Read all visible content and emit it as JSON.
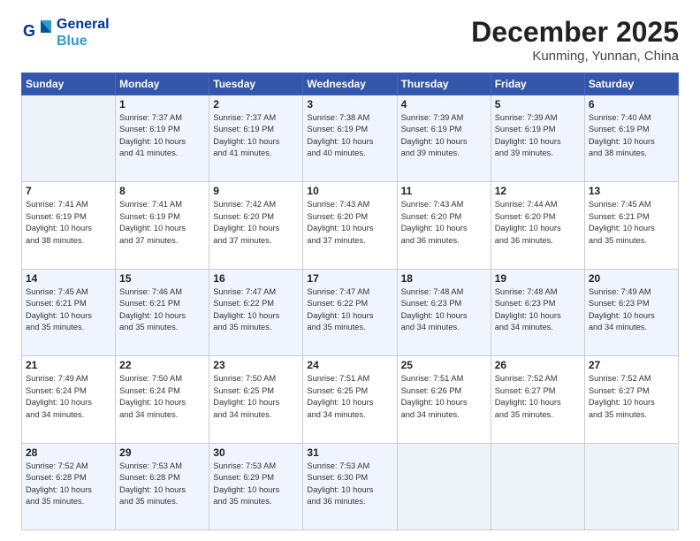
{
  "logo": {
    "line1": "General",
    "line2": "Blue"
  },
  "title": "December 2025",
  "location": "Kunming, Yunnan, China",
  "weekdays": [
    "Sunday",
    "Monday",
    "Tuesday",
    "Wednesday",
    "Thursday",
    "Friday",
    "Saturday"
  ],
  "weeks": [
    [
      {
        "day": "",
        "detail": ""
      },
      {
        "day": "1",
        "detail": "Sunrise: 7:37 AM\nSunset: 6:19 PM\nDaylight: 10 hours\nand 41 minutes."
      },
      {
        "day": "2",
        "detail": "Sunrise: 7:37 AM\nSunset: 6:19 PM\nDaylight: 10 hours\nand 41 minutes."
      },
      {
        "day": "3",
        "detail": "Sunrise: 7:38 AM\nSunset: 6:19 PM\nDaylight: 10 hours\nand 40 minutes."
      },
      {
        "day": "4",
        "detail": "Sunrise: 7:39 AM\nSunset: 6:19 PM\nDaylight: 10 hours\nand 39 minutes."
      },
      {
        "day": "5",
        "detail": "Sunrise: 7:39 AM\nSunset: 6:19 PM\nDaylight: 10 hours\nand 39 minutes."
      },
      {
        "day": "6",
        "detail": "Sunrise: 7:40 AM\nSunset: 6:19 PM\nDaylight: 10 hours\nand 38 minutes."
      }
    ],
    [
      {
        "day": "7",
        "detail": "Sunrise: 7:41 AM\nSunset: 6:19 PM\nDaylight: 10 hours\nand 38 minutes."
      },
      {
        "day": "8",
        "detail": "Sunrise: 7:41 AM\nSunset: 6:19 PM\nDaylight: 10 hours\nand 37 minutes."
      },
      {
        "day": "9",
        "detail": "Sunrise: 7:42 AM\nSunset: 6:20 PM\nDaylight: 10 hours\nand 37 minutes."
      },
      {
        "day": "10",
        "detail": "Sunrise: 7:43 AM\nSunset: 6:20 PM\nDaylight: 10 hours\nand 37 minutes."
      },
      {
        "day": "11",
        "detail": "Sunrise: 7:43 AM\nSunset: 6:20 PM\nDaylight: 10 hours\nand 36 minutes."
      },
      {
        "day": "12",
        "detail": "Sunrise: 7:44 AM\nSunset: 6:20 PM\nDaylight: 10 hours\nand 36 minutes."
      },
      {
        "day": "13",
        "detail": "Sunrise: 7:45 AM\nSunset: 6:21 PM\nDaylight: 10 hours\nand 35 minutes."
      }
    ],
    [
      {
        "day": "14",
        "detail": "Sunrise: 7:45 AM\nSunset: 6:21 PM\nDaylight: 10 hours\nand 35 minutes."
      },
      {
        "day": "15",
        "detail": "Sunrise: 7:46 AM\nSunset: 6:21 PM\nDaylight: 10 hours\nand 35 minutes."
      },
      {
        "day": "16",
        "detail": "Sunrise: 7:47 AM\nSunset: 6:22 PM\nDaylight: 10 hours\nand 35 minutes."
      },
      {
        "day": "17",
        "detail": "Sunrise: 7:47 AM\nSunset: 6:22 PM\nDaylight: 10 hours\nand 35 minutes."
      },
      {
        "day": "18",
        "detail": "Sunrise: 7:48 AM\nSunset: 6:23 PM\nDaylight: 10 hours\nand 34 minutes."
      },
      {
        "day": "19",
        "detail": "Sunrise: 7:48 AM\nSunset: 6:23 PM\nDaylight: 10 hours\nand 34 minutes."
      },
      {
        "day": "20",
        "detail": "Sunrise: 7:49 AM\nSunset: 6:23 PM\nDaylight: 10 hours\nand 34 minutes."
      }
    ],
    [
      {
        "day": "21",
        "detail": "Sunrise: 7:49 AM\nSunset: 6:24 PM\nDaylight: 10 hours\nand 34 minutes."
      },
      {
        "day": "22",
        "detail": "Sunrise: 7:50 AM\nSunset: 6:24 PM\nDaylight: 10 hours\nand 34 minutes."
      },
      {
        "day": "23",
        "detail": "Sunrise: 7:50 AM\nSunset: 6:25 PM\nDaylight: 10 hours\nand 34 minutes."
      },
      {
        "day": "24",
        "detail": "Sunrise: 7:51 AM\nSunset: 6:25 PM\nDaylight: 10 hours\nand 34 minutes."
      },
      {
        "day": "25",
        "detail": "Sunrise: 7:51 AM\nSunset: 6:26 PM\nDaylight: 10 hours\nand 34 minutes."
      },
      {
        "day": "26",
        "detail": "Sunrise: 7:52 AM\nSunset: 6:27 PM\nDaylight: 10 hours\nand 35 minutes."
      },
      {
        "day": "27",
        "detail": "Sunrise: 7:52 AM\nSunset: 6:27 PM\nDaylight: 10 hours\nand 35 minutes."
      }
    ],
    [
      {
        "day": "28",
        "detail": "Sunrise: 7:52 AM\nSunset: 6:28 PM\nDaylight: 10 hours\nand 35 minutes."
      },
      {
        "day": "29",
        "detail": "Sunrise: 7:53 AM\nSunset: 6:28 PM\nDaylight: 10 hours\nand 35 minutes."
      },
      {
        "day": "30",
        "detail": "Sunrise: 7:53 AM\nSunset: 6:29 PM\nDaylight: 10 hours\nand 35 minutes."
      },
      {
        "day": "31",
        "detail": "Sunrise: 7:53 AM\nSunset: 6:30 PM\nDaylight: 10 hours\nand 36 minutes."
      },
      {
        "day": "",
        "detail": ""
      },
      {
        "day": "",
        "detail": ""
      },
      {
        "day": "",
        "detail": ""
      }
    ]
  ]
}
